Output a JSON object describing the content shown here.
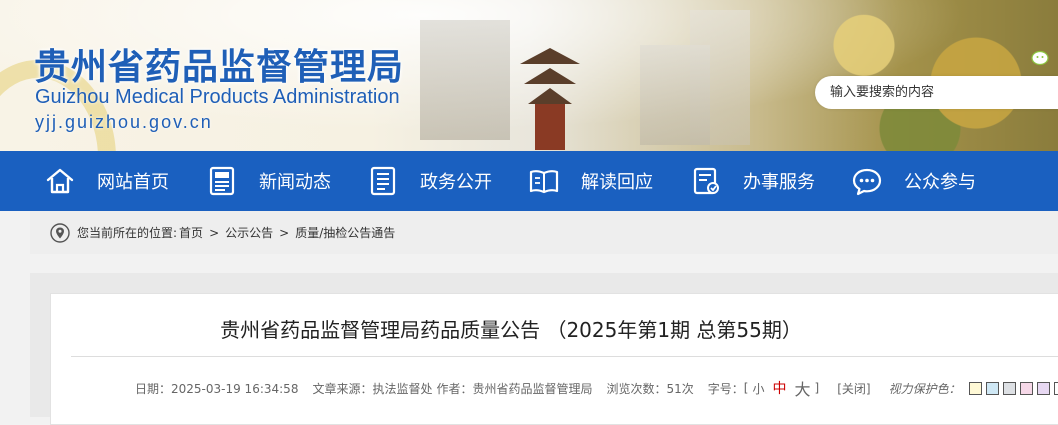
{
  "header": {
    "title": "贵州省药品监督管理局",
    "subtitle": "Guizhou Medical Products Administration",
    "domain": "yjj.guizhou.gov.cn",
    "search_placeholder": "输入要搜索的内容"
  },
  "nav": {
    "items": [
      {
        "label": "网站首页",
        "icon": "home-icon"
      },
      {
        "label": "新闻动态",
        "icon": "news-icon"
      },
      {
        "label": "政务公开",
        "icon": "document-list-icon"
      },
      {
        "label": "解读回应",
        "icon": "open-book-icon"
      },
      {
        "label": "办事服务",
        "icon": "service-form-icon"
      },
      {
        "label": "公众参与",
        "icon": "chat-bubble-icon"
      }
    ]
  },
  "breadcrumb": {
    "prefix": "您当前所在的位置:",
    "items": [
      "首页",
      "公示公告",
      "质量/抽检公告通告"
    ],
    "separator": ">"
  },
  "article": {
    "title": "贵州省药品监督管理局药品质量公告 （2025年第1期 总第55期）",
    "date": "日期：2025-03-19 16:34:58",
    "source": "文章来源：执法监督处",
    "author": "作者：贵州省药品监督管理局",
    "views": "浏览次数：51次",
    "font_size_label": "字号：",
    "font_size_open": "[",
    "font_sizes": [
      "小",
      "中",
      "大"
    ],
    "font_size_close": "]",
    "close_label": "[关闭]",
    "vision_label": "视力保护色："
  },
  "colors": {
    "brand_blue": "#1a60c0",
    "title_blue": "#1f5fb7",
    "swatches": [
      "#fff9d6",
      "#cfe8f5",
      "#dde0e4",
      "#f6d8e8",
      "#e7d8f2",
      "#ffffff"
    ]
  }
}
